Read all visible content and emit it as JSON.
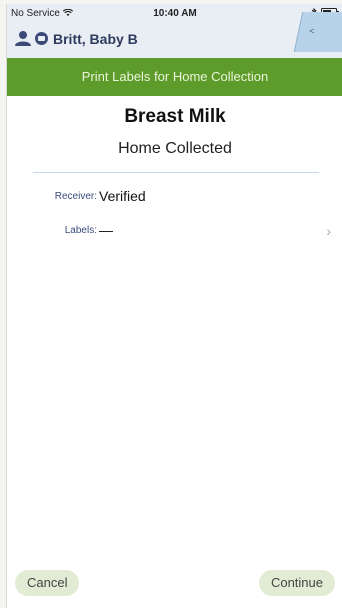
{
  "status_bar": {
    "carrier": "No Service",
    "time": "10:40 AM"
  },
  "patient": {
    "name": "Britt, Baby B"
  },
  "header": {
    "title": "Print Labels for Home Collection"
  },
  "main": {
    "title": "Breast Milk",
    "subtitle": "Home Collected",
    "fields": [
      {
        "label": "Receiver:",
        "value": "Verified"
      },
      {
        "label": "Labels:",
        "value": "—"
      }
    ]
  },
  "footer": {
    "cancel_label": "Cancel",
    "continue_label": "Continue"
  },
  "colors": {
    "header_green": "#5d9b2b",
    "patient_text": "#2f3a5f",
    "back_tab": "#b7d3ea",
    "button_bg": "#e2ebd4"
  },
  "icons": [
    "wifi-icon",
    "bluetooth-icon",
    "battery-icon",
    "person-icon",
    "patient-id-icon",
    "back-tab-icon",
    "chevron-right-icon"
  ]
}
